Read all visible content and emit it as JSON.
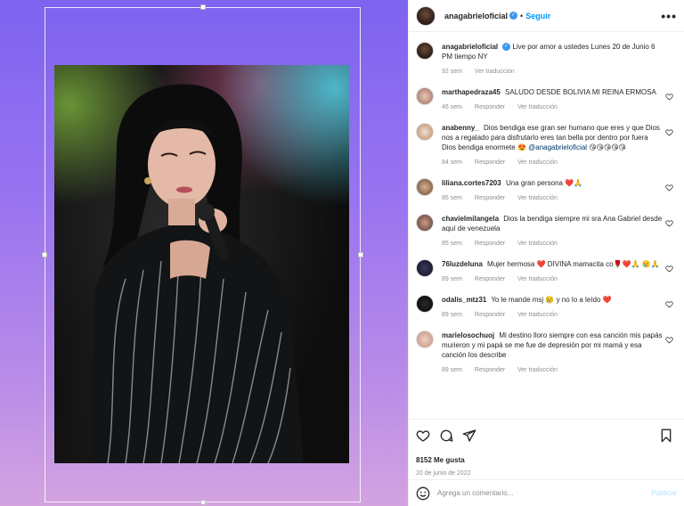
{
  "post": {
    "username": "anagabrieloficial",
    "follow_label": "Seguir",
    "more_label": "•••",
    "caption": "Live por amor a ustedes Lunes 20 de Junio 6 PM tiempo NY",
    "caption_time": "92 sem",
    "caption_translate": "Ver traducción",
    "likes": "8152 Me gusta",
    "date": "20 de junio de 2022"
  },
  "comments": [
    {
      "user": "marthapedraza45",
      "text": "SALUDO DESDE BOLIVIA MI REINA ERMOSA",
      "time": "46 sem",
      "reply": "Responder",
      "translate": "Ver traducción"
    },
    {
      "user": "anabenny_",
      "text": "Dios bendiga ese gran ser humano que eres y que Dios nos a regalado para disfrutarlo eres tan bella por dentro por fuera Dios bendiga enormete 😍",
      "mention": "@anagabrieloficial",
      "emoji_after": "😘😘😘😘😘",
      "time": "84 sem",
      "reply": "Responder",
      "translate": "Ver traducción"
    },
    {
      "user": "liliana.cortes7203",
      "text": "Una gran persona ❤️🙏",
      "time": "85 sem",
      "reply": "Responder",
      "translate": "Ver traducción"
    },
    {
      "user": "chavielmilangela",
      "text": "Dios la bendiga siempre mi sra Ana Gabriel desde aquí de venezuela",
      "time": "85 sem",
      "reply": "Responder",
      "translate": "Ver traducción"
    },
    {
      "user": "76luzdeluna",
      "text": "Mujer hermosa ❤️ DIVINA mamacita co🌹❤️🙏 😢🙏",
      "time": "89 sem",
      "reply": "Responder",
      "translate": "Ver traducción"
    },
    {
      "user": "odalis_mtz31",
      "text": "Yo le mande msj 😢 y no lo a leído ❤️",
      "time": "89 sem",
      "reply": "Responder",
      "translate": "Ver traducción"
    },
    {
      "user": "marielosochuoj",
      "text": "Mi destino lloro siempre con esa canción mis papás murieron y mi papá se me fue de depresión por mi mamá y esa canción los describe",
      "time": "89 sem",
      "reply": "Responder",
      "translate": "Ver traducción"
    }
  ],
  "composer": {
    "placeholder": "Agrega un comentario...",
    "publish_label": "Publicar"
  },
  "colors": {
    "accent": "#0095f6",
    "verified": "#3897f0",
    "heart_red": "#ed4956",
    "muted": "#8e8e8e"
  },
  "icons": [
    "more-icon",
    "heart-icon",
    "comment-icon",
    "share-icon",
    "bookmark-icon",
    "emoji-icon",
    "verified-icon"
  ]
}
